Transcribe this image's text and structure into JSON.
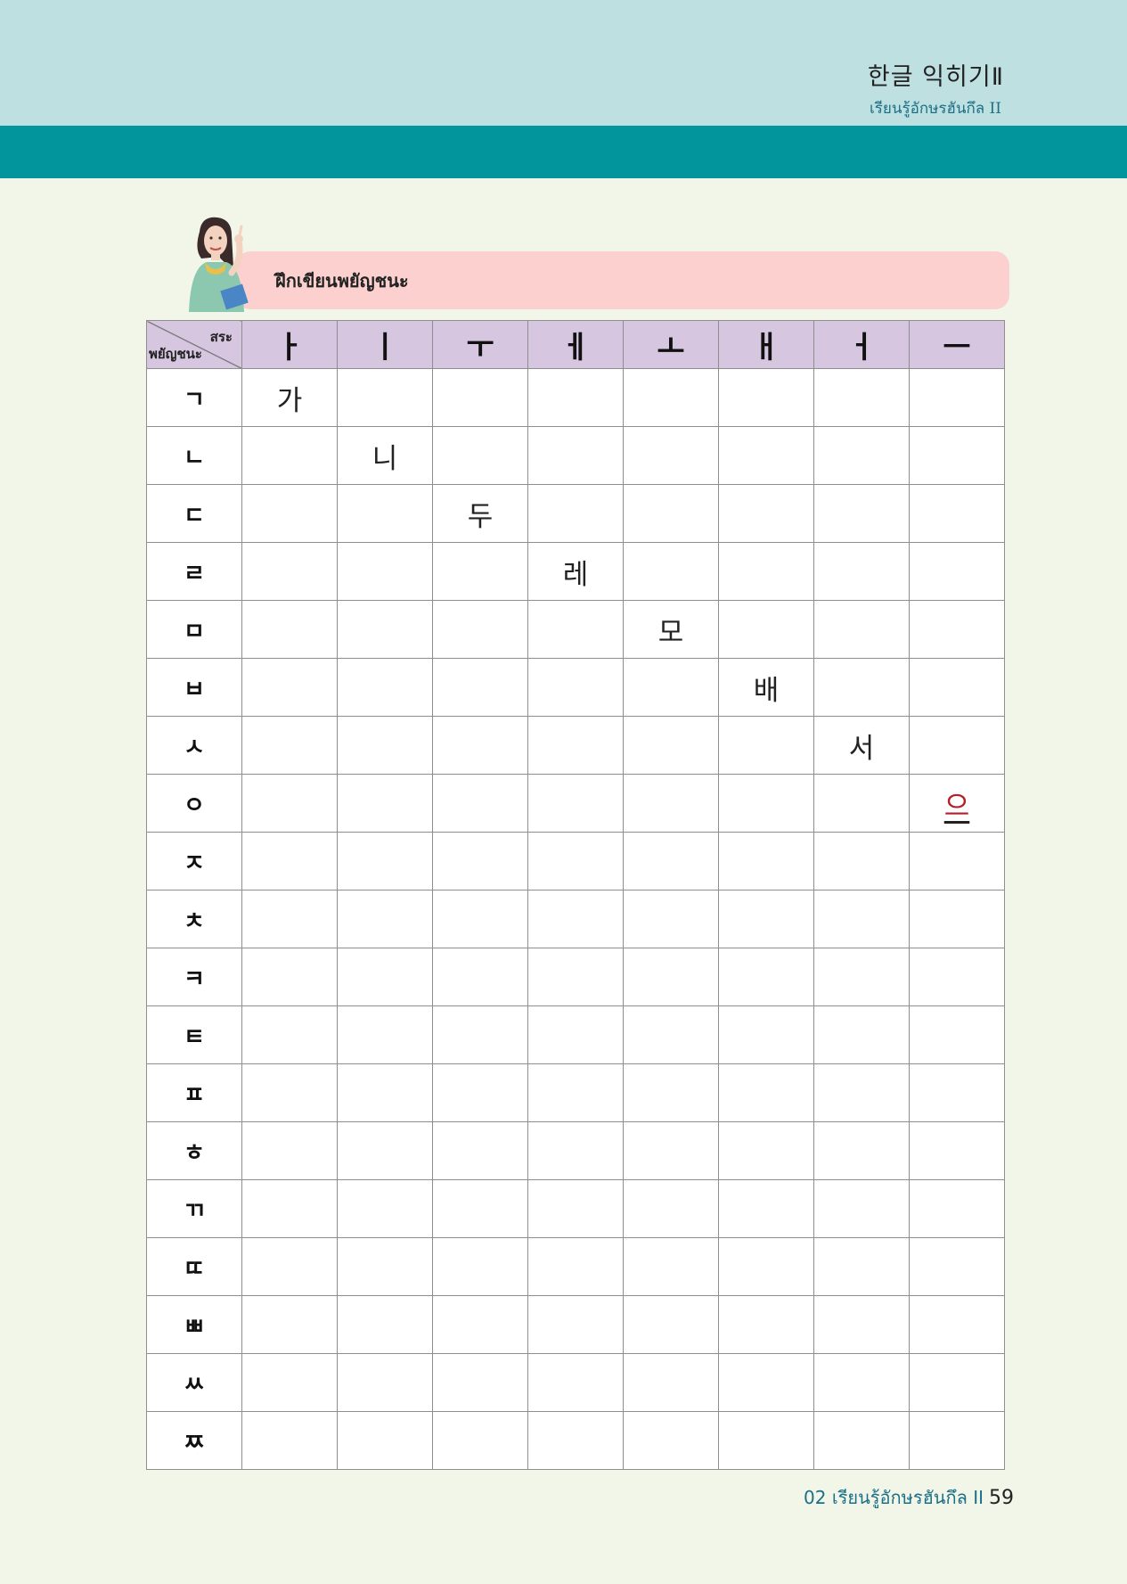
{
  "header": {
    "title": "한글 익히기Ⅱ",
    "subtitle": "เรียนรู้อักษรฮันกึล II"
  },
  "instruction": {
    "label": "ฝึกเขียนพยัญชนะ",
    "illustration_icon": "teacher-pointing-illustration"
  },
  "table": {
    "corner_vowel_label": "สระ",
    "corner_consonant_label": "พยัญชนะ",
    "vowels": [
      "ㅏ",
      "ㅣ",
      "ㅜ",
      "ㅔ",
      "ㅗ",
      "ㅐ",
      "ㅓ",
      "ㅡ"
    ],
    "rows": [
      {
        "consonant": "ㄱ",
        "cells": [
          "가",
          "",
          "",
          "",
          "",
          "",
          "",
          ""
        ]
      },
      {
        "consonant": "ㄴ",
        "cells": [
          "",
          "니",
          "",
          "",
          "",
          "",
          "",
          ""
        ]
      },
      {
        "consonant": "ㄷ",
        "cells": [
          "",
          "",
          "두",
          "",
          "",
          "",
          "",
          ""
        ]
      },
      {
        "consonant": "ㄹ",
        "cells": [
          "",
          "",
          "",
          "레",
          "",
          "",
          "",
          ""
        ]
      },
      {
        "consonant": "ㅁ",
        "cells": [
          "",
          "",
          "",
          "",
          "모",
          "",
          "",
          ""
        ]
      },
      {
        "consonant": "ㅂ",
        "cells": [
          "",
          "",
          "",
          "",
          "",
          "배",
          "",
          ""
        ]
      },
      {
        "consonant": "ㅅ",
        "cells": [
          "",
          "",
          "",
          "",
          "",
          "",
          "서",
          ""
        ]
      },
      {
        "consonant": "ㅇ",
        "cells": [
          "",
          "",
          "",
          "",
          "",
          "",
          "",
          "으"
        ]
      },
      {
        "consonant": "ㅈ",
        "cells": [
          "",
          "",
          "",
          "",
          "",
          "",
          "",
          ""
        ]
      },
      {
        "consonant": "ㅊ",
        "cells": [
          "",
          "",
          "",
          "",
          "",
          "",
          "",
          ""
        ]
      },
      {
        "consonant": "ㅋ",
        "cells": [
          "",
          "",
          "",
          "",
          "",
          "",
          "",
          ""
        ]
      },
      {
        "consonant": "ㅌ",
        "cells": [
          "",
          "",
          "",
          "",
          "",
          "",
          "",
          ""
        ]
      },
      {
        "consonant": "ㅍ",
        "cells": [
          "",
          "",
          "",
          "",
          "",
          "",
          "",
          ""
        ]
      },
      {
        "consonant": "ㅎ",
        "cells": [
          "",
          "",
          "",
          "",
          "",
          "",
          "",
          ""
        ]
      },
      {
        "consonant": "ㄲ",
        "cells": [
          "",
          "",
          "",
          "",
          "",
          "",
          "",
          ""
        ]
      },
      {
        "consonant": "ㄸ",
        "cells": [
          "",
          "",
          "",
          "",
          "",
          "",
          "",
          ""
        ]
      },
      {
        "consonant": "ㅃ",
        "cells": [
          "",
          "",
          "",
          "",
          "",
          "",
          "",
          ""
        ]
      },
      {
        "consonant": "ㅆ",
        "cells": [
          "",
          "",
          "",
          "",
          "",
          "",
          "",
          ""
        ]
      },
      {
        "consonant": "ㅉ",
        "cells": [
          "",
          "",
          "",
          "",
          "",
          "",
          "",
          ""
        ]
      }
    ],
    "highlight_color": "#b32026"
  },
  "footer": {
    "section": "02 เรียนรู้อักษรฮันกึล II",
    "page_number": "59"
  },
  "colors": {
    "top_band": "#bfe0e0",
    "teal_band": "#02959b",
    "page_bg": "#f2f6e9",
    "banner": "#fbd0cf",
    "header_row": "#d6c6e0"
  }
}
